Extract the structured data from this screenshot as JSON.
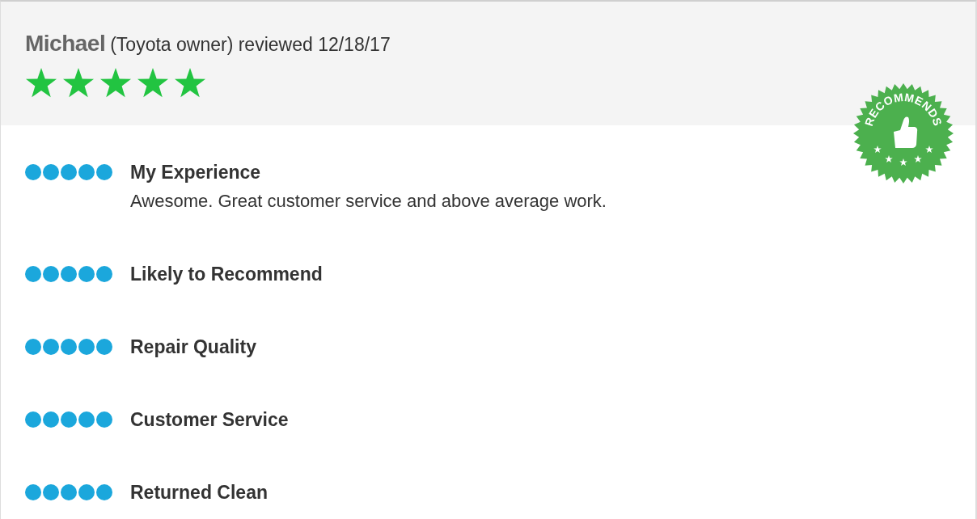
{
  "review": {
    "author": "Michael",
    "detail": "(Toyota owner) reviewed 12/18/17",
    "stars": 5
  },
  "badge": {
    "label": "RECOMMENDS"
  },
  "criteria": [
    {
      "title": "My Experience",
      "stars": 5,
      "comment": "Awesome. Great customer service and above average work."
    },
    {
      "title": "Likely to Recommend",
      "stars": 5
    },
    {
      "title": "Repair Quality",
      "stars": 5
    },
    {
      "title": "Customer Service",
      "stars": 5
    },
    {
      "title": "Returned Clean",
      "stars": 5
    }
  ]
}
